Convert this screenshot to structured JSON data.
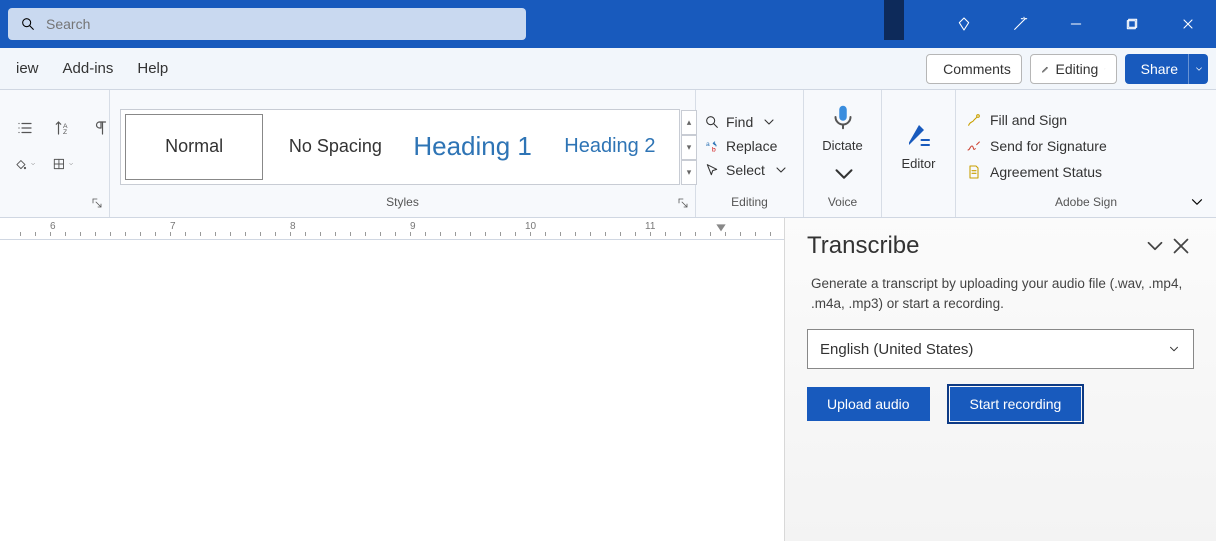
{
  "titlebar": {
    "search_placeholder": "Search"
  },
  "tabs": {
    "view": "iew",
    "addins": "Add-ins",
    "help": "Help"
  },
  "actions": {
    "comments": "Comments",
    "editing": "Editing",
    "share": "Share"
  },
  "ribbon": {
    "styles_label": "Styles",
    "editing_label": "Editing",
    "voice_label": "Voice",
    "adobe_label": "Adobe Sign",
    "styles": {
      "normal": "Normal",
      "nospacing": "No Spacing",
      "h1": "Heading 1",
      "h2": "Heading 2"
    },
    "editing": {
      "find": "Find",
      "replace": "Replace",
      "select": "Select"
    },
    "voice": {
      "dictate": "Dictate"
    },
    "editor": {
      "editor": "Editor"
    },
    "adobe": {
      "fill": "Fill and Sign",
      "send": "Send for Signature",
      "status": "Agreement Status"
    }
  },
  "ruler": {
    "n6": "6",
    "n7": "7",
    "n8": "8",
    "n9": "9",
    "n10": "10",
    "n11": "11"
  },
  "pane": {
    "title": "Transcribe",
    "desc": "Generate a transcript by uploading your audio file (.wav, .mp4, .m4a, .mp3) or start a recording.",
    "language": "English (United States)",
    "upload": "Upload audio",
    "record": "Start recording"
  }
}
